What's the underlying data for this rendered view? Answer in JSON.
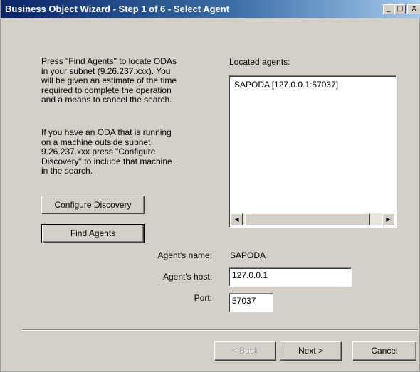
{
  "window": {
    "title": "Business Object Wizard - Step 1 of 6 - Select Agent",
    "controls": {
      "minimize": "_",
      "maximize": "□",
      "close": "X"
    }
  },
  "instructions": {
    "paragraph1": [
      "Press \"Find Agents\" to locate ODAs",
      "in your subnet (9.26.237.xxx). You",
      "will be given an estimate of the time",
      "required to complete the operation",
      "and a means to cancel the search."
    ],
    "paragraph2": [
      "If you have an ODA that is running",
      "on a machine outside subnet",
      "9.26.237.xxx press \"Configure",
      "Discovery\" to include that machine",
      "in the search."
    ]
  },
  "buttons": {
    "configure_discovery": "Configure Discovery",
    "find_agents": "Find Agents",
    "back": "< Back",
    "next": "Next >",
    "cancel": "Cancel"
  },
  "located_agents": {
    "label": "Located agents:",
    "items": [
      "SAPODA [127.0.0.1:57037]"
    ]
  },
  "agent_details": {
    "name_label": "Agent's name:",
    "name_value": "SAPODA",
    "host_label": "Agent's host:",
    "host_value": "127.0.0.1",
    "port_label": "Port:",
    "port_value": "57037"
  },
  "icons": {
    "scroll_left": "scroll-left-arrow-icon",
    "scroll_right": "scroll-right-arrow-icon"
  }
}
